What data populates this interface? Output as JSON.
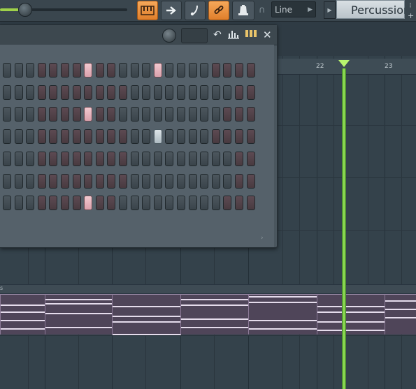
{
  "toolbar": {
    "snap_mode": "Line",
    "channel_filter": "Percussion",
    "buttons": [
      "piano-roll-icon",
      "arrow-right-icon",
      "note-icon",
      "link-icon",
      "metronome-bell-icon"
    ],
    "plus_label": "+",
    "magnet_icon": "magnet-icon"
  },
  "ruler": {
    "bar_22": "22",
    "bar_23": "23"
  },
  "playlist": {
    "track_label": "s"
  },
  "rack": {
    "close_icon": "✕",
    "undo_icon": "↶",
    "scroll_glyph": "›",
    "rows": [
      "gggmmmmonmmgggonggggmmmmonmmgggmmmmm",
      "gggmmmmmmmmgggggggggmmmmmmmmgggmmmmm",
      "gggmmmmonmmgggggggggmmmmonmmgggmmmmm",
      "gggmmmmmmmmggonwggggmmmmonmmgggmmmmm",
      "gggmmmmmmmmgggggggggmmmmmmmmgggmmonmm",
      "gggmmmmmmmmgggggggggmmmmonmmgggononon",
      "gggmmmmonmmgggggggggmmmmmmmonmmgggononmm"
    ]
  },
  "colors": {
    "accent_orange": "#e98a36",
    "playhead_green": "#9ef25c",
    "step_on_pink": "#e6b3bc"
  }
}
